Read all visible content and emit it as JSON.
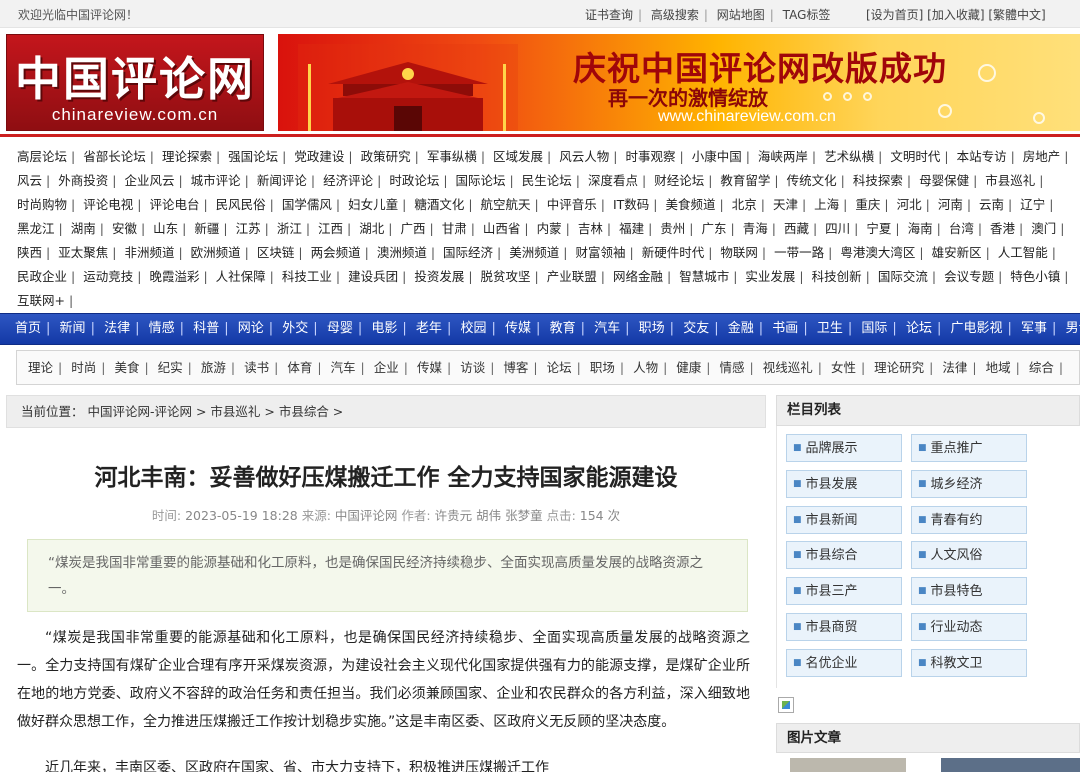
{
  "topbar": {
    "welcome": "欢迎光临中国评论网！",
    "links": [
      "证书查询",
      "高级搜索",
      "网站地图",
      "TAG标签"
    ],
    "right": "[设为首页] [加入收藏] [繁體中文]"
  },
  "logo": {
    "cn": "中国评论网",
    "en": "chinareview.com.cn"
  },
  "banner": {
    "headline": "庆祝中国评论网改版成功",
    "sub": "再一次的激情绽放",
    "url": "www.chinareview.com.cn"
  },
  "channels": [
    "高层论坛",
    "省部长论坛",
    "理论探索",
    "强国论坛",
    "党政建设",
    "政策研究",
    "军事纵横",
    "区域发展",
    "风云人物",
    "时事观察",
    "小康中国",
    "海峡两岸",
    "艺术纵横",
    "文明时代",
    "本站专访",
    "房地产",
    "风云",
    "外商投资",
    "企业风云",
    "城市评论",
    "新闻评论",
    "经济评论",
    "时政论坛",
    "国际论坛",
    "民生论坛",
    "深度看点",
    "财经论坛",
    "教育留学",
    "传统文化",
    "科技探索",
    "母婴保健",
    "市县巡礼",
    "时尚购物",
    "评论电视",
    "评论电台",
    "民风民俗",
    "国学儒风",
    "妇女儿童",
    "糖酒文化",
    "航空航天",
    "中评音乐",
    "IT数码",
    "美食频道",
    "北京",
    "天津",
    "上海",
    "重庆",
    "河北",
    "河南",
    "云南",
    "辽宁",
    "黑龙江",
    "湖南",
    "安徽",
    "山东",
    "新疆",
    "江苏",
    "浙江",
    "江西",
    "湖北",
    "广西",
    "甘肃",
    "山西省",
    "内蒙",
    "吉林",
    "福建",
    "贵州",
    "广东",
    "青海",
    "西藏",
    "四川",
    "宁夏",
    "海南",
    "台湾",
    "香港",
    "澳门",
    "陕西",
    "亚太聚焦",
    "非洲频道",
    "欧洲频道",
    "区块链",
    "两会频道",
    "澳洲频道",
    "国际经济",
    "美洲频道",
    "财富领袖",
    "新硬件时代",
    "物联网",
    "一带一路",
    "粤港澳大湾区",
    "雄安新区",
    "人工智能",
    "民政企业",
    "运动竞技",
    "晚霞溢彩",
    "人社保障",
    "科技工业",
    "建设兵团",
    "投资发展",
    "脱贫攻坚",
    "产业联盟",
    "网络金融",
    "智慧城市",
    "实业发展",
    "科技创新",
    "国际交流",
    "会议专题",
    "特色小镇",
    "互联网+"
  ],
  "main_nav": [
    "首页",
    "新闻",
    "法律",
    "情感",
    "科普",
    "网论",
    "外交",
    "母婴",
    "电影",
    "老年",
    "校园",
    "传媒",
    "教育",
    "汽车",
    "职场",
    "交友",
    "金融",
    "书画",
    "卫生",
    "国际",
    "论坛",
    "广电影视",
    "军事",
    "男士"
  ],
  "sub_nav": [
    "理论",
    "时尚",
    "美食",
    "纪实",
    "旅游",
    "读书",
    "体育",
    "汽车",
    "企业",
    "传媒",
    "访谈",
    "博客",
    "论坛",
    "职场",
    "人物",
    "健康",
    "情感",
    "视线巡礼",
    "女性",
    "理论研究",
    "法律",
    "地域",
    "综合"
  ],
  "breadcrumb": "当前位置： 中国评论网-评论网 > 市县巡礼 > 市县综合 >",
  "article": {
    "title": "河北丰南：妥善做好压煤搬迁工作 全力支持国家能源建设",
    "time_label": "时间:",
    "time": "2023-05-19 18:28",
    "source_label": "来源:",
    "source": "中国评论网",
    "author_label": "作者:",
    "author": "许贵元 胡伟 张梦童",
    "clicks_label": "点击:",
    "clicks": "154 次",
    "summary": "“煤炭是我国非常重要的能源基础和化工原料，也是确保国民经济持续稳步、全面实现高质量发展的战略资源之一。",
    "body": "“煤炭是我国非常重要的能源基础和化工原料，也是确保国民经济持续稳步、全面实现高质量发展的战略资源之一。全力支持国有煤矿企业合理有序开采煤炭资源，为建设社会主义现代化国家提供强有力的能源支撑，是煤矿企业所在地的地方党委、政府义不容辞的政治任务和责任担当。我们必须兼顾国家、企业和农民群众的各方利益，深入细致地做好群众思想工作，全力推进压煤搬迁工作按计划稳步实施。”这是丰南区委、区政府义无反顾的坚决态度。",
    "body_cut": "近几年来，丰南区委、区政府在国家、省、市大力支持下，积极推进压煤搬迁工作"
  },
  "sidebar": {
    "heading": "栏目列表",
    "items": [
      "品牌展示",
      "重点推广",
      "市县发展",
      "城乡经济",
      "市县新闻",
      "青春有约",
      "市县综合",
      "人文风俗",
      "市县三产",
      "市县特色",
      "市县商贸",
      "行业动态",
      "名优企业",
      "科教文卫"
    ],
    "pic_heading": "图片文章"
  },
  "colors": {
    "accent_red": "#c4161c",
    "nav_blue": "#1a3fae",
    "side_btn": "#eaf3fb"
  }
}
